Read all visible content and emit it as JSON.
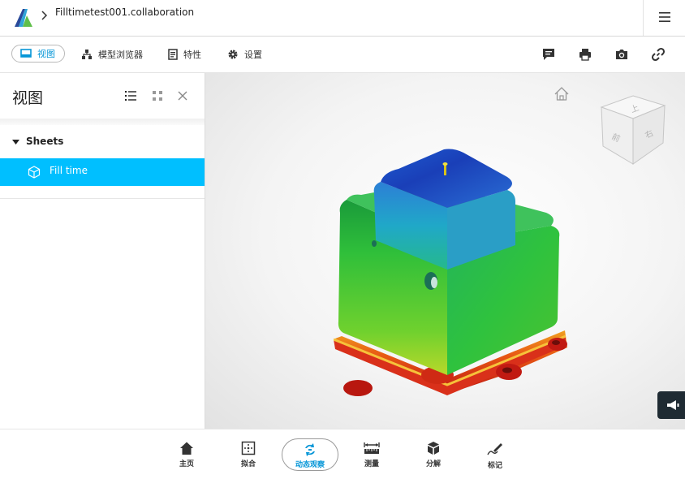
{
  "header": {
    "doc_title": "Filltimetest001.collaboration"
  },
  "toolbar": {
    "tools": [
      {
        "label": "视图",
        "icon": "view-icon",
        "active": true
      },
      {
        "label": "模型浏览器",
        "icon": "model-browser-icon",
        "active": false
      },
      {
        "label": "特性",
        "icon": "properties-icon",
        "active": false
      },
      {
        "label": "设置",
        "icon": "gear-icon",
        "active": false
      }
    ],
    "right_icons": [
      "comment-icon",
      "print-icon",
      "camera-icon",
      "link-icon"
    ]
  },
  "panel": {
    "title": "视图",
    "tree": {
      "group_label": "Sheets",
      "items": [
        {
          "label": "Fill time",
          "selected": true
        }
      ]
    }
  },
  "viewport": {
    "viewcube_faces": [
      "上",
      "前",
      "右"
    ]
  },
  "bottombar": {
    "tools": [
      {
        "label": "主页",
        "icon": "home-icon",
        "active": false
      },
      {
        "label": "拟合",
        "icon": "fit-icon",
        "active": false
      },
      {
        "label": "动态观察",
        "icon": "orbit-icon",
        "active": true
      },
      {
        "label": "测量",
        "icon": "measure-icon",
        "active": false
      },
      {
        "label": "分解",
        "icon": "explode-icon",
        "active": false
      },
      {
        "label": "标记",
        "icon": "markup-icon",
        "active": false
      }
    ]
  },
  "colors": {
    "accent": "#0696d7",
    "selection": "#00bfff"
  }
}
